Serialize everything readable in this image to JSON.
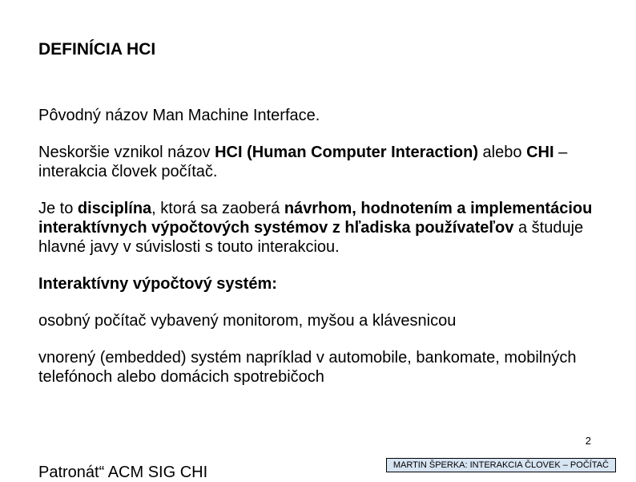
{
  "title": "DEFINÍCIA HCI",
  "para1": "Pôvodný názov Man Machine Interface.",
  "para2_a": "Neskoršie vznikol názov ",
  "para2_b": "HCI (Human Computer Interaction)",
  "para2_c": " alebo ",
  "para2_d": "CHI",
  "para2_e": " – interakcia človek počítač.",
  "para3_a": "Je to ",
  "para3_b": "disciplína",
  "para3_c": ", ktorá sa zaoberá ",
  "para3_d": "návrhom, hodnotením a implementáciou interaktívnych výpočtových systémov z hľadiska používateľov",
  "para3_e": " a študuje hlavné javy v súvislosti s touto interakciou.",
  "para4": "Interaktívny výpočtový systém:",
  "para5": "osobný počítač vybavený monitorom, myšou a klávesnicou",
  "para6": "vnorený (embedded) systém napríklad v automobile, bankomate, mobilných telefónoch alebo domácich spotrebičoch",
  "cutoff": "Patronát“ ACM SIG CHI",
  "page_number": "2",
  "footer": "MARTIN ŠPERKA: INTERAKCIA ČLOVEK – POČÍTAČ"
}
